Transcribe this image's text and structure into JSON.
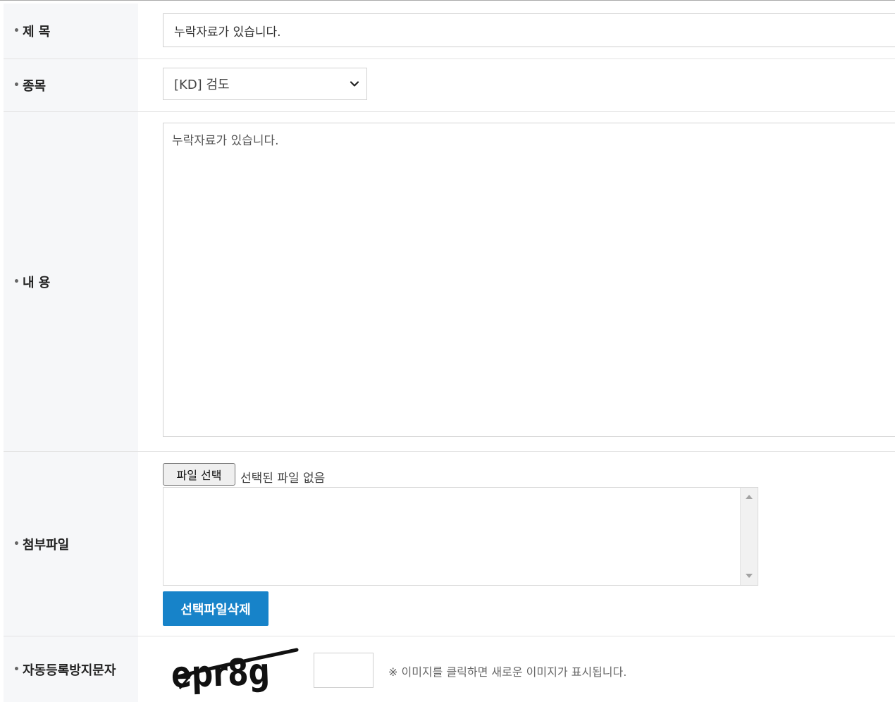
{
  "form": {
    "subject": {
      "label": "제 목",
      "value": "누락자료가 있습니다."
    },
    "category": {
      "label": "종목",
      "selected": "[KD] 검도"
    },
    "content": {
      "label": "내 용",
      "value": "누락자료가 있습니다."
    },
    "attachment": {
      "label": "첨부파일",
      "choose_button": "파일 선택",
      "status": "선택된 파일 없음",
      "delete_button": "선택파일삭제"
    },
    "captcha": {
      "label": "자동등록방지문자",
      "image_text": "epr8g",
      "input_value": "",
      "hint": "※ 이미지를 클릭하면 새로운 이미지가 표시됩니다."
    }
  },
  "icons": {
    "bullet": "•",
    "select_arrow": "chevron-down-icon"
  },
  "colors": {
    "label_bg": "#f6f7f9",
    "primary_button": "#1783c9"
  }
}
